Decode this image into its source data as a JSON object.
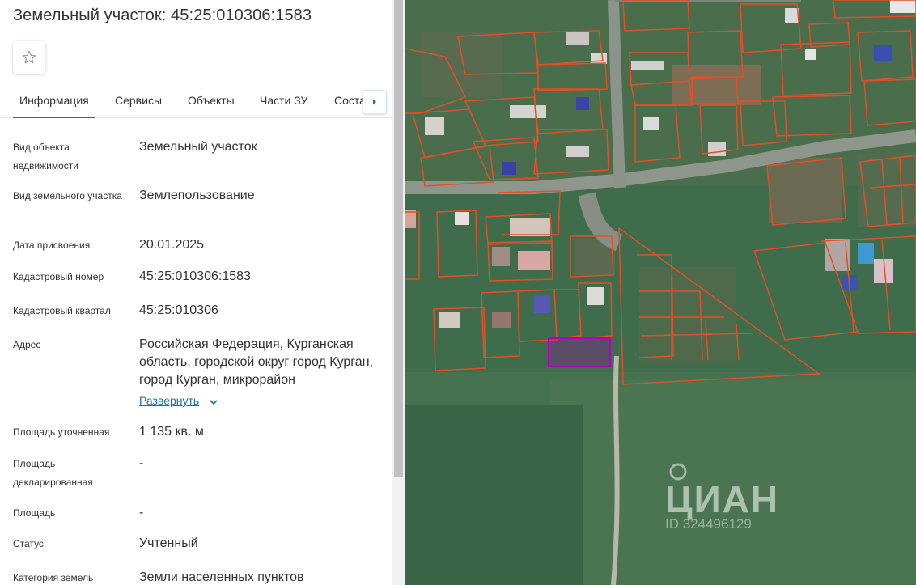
{
  "header": {
    "title": "Земельный участок: 45:25:010306:1583",
    "favorite_icon": "star-icon"
  },
  "tabs": [
    {
      "label": "Информация"
    },
    {
      "label": "Сервисы"
    },
    {
      "label": "Объекты"
    },
    {
      "label": "Части ЗУ"
    },
    {
      "label": "Состав"
    }
  ],
  "info": {
    "rows": [
      {
        "label": "Вид объекта недвижимости",
        "value": "Земельный участок"
      },
      {
        "label": "Вид земельного участка",
        "value": "Землепользование"
      },
      {
        "label": "Дата присвоения",
        "value": "20.01.2025"
      },
      {
        "label": "Кадастровый номер",
        "value": "45:25:010306:1583"
      },
      {
        "label": "Кадастровый квартал",
        "value": "45:25:010306"
      },
      {
        "label": "Адрес",
        "value": "Российская Федерация, Курганская область, городской округ город Курган, город Курган, микрорайон"
      },
      {
        "label": "Площадь уточненная",
        "value": "1 135 кв. м"
      },
      {
        "label": "Площадь декларированная",
        "value": "-"
      },
      {
        "label": "Площадь",
        "value": "-"
      },
      {
        "label": "Статус",
        "value": "Учтенный"
      },
      {
        "label": "Категория земель",
        "value": "Земли населенных пунктов"
      }
    ],
    "expand_label": "Развернуть"
  },
  "map": {
    "watermark": "ЦИАН",
    "watermark_id": "ID 324496129",
    "parcel_color": "#e0502a",
    "selected_color": "#b000c0"
  }
}
